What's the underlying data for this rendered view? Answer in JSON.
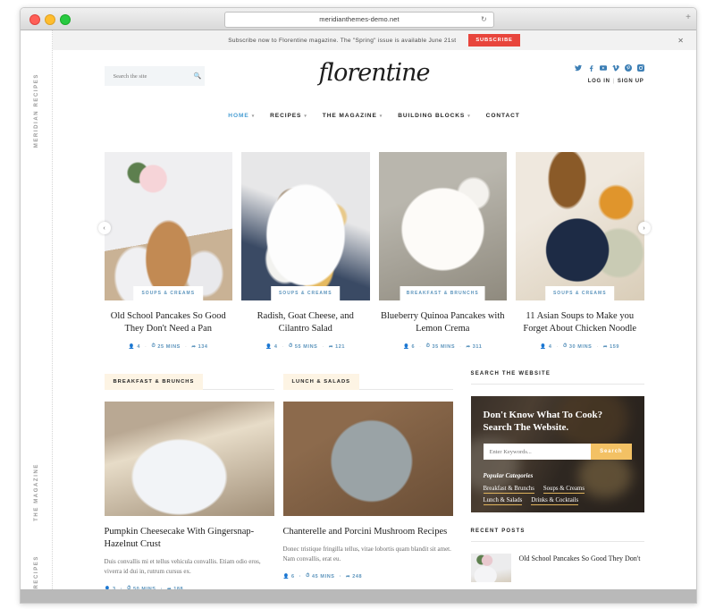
{
  "browser": {
    "url": "meridianthemes-demo.net",
    "reload_icon": "reload-icon",
    "new_tab_icon": "plus-icon"
  },
  "notice": {
    "text": "Subscribe now to Florentine magazine. The \"Spring\" issue is available June 21st",
    "button": "SUBSCRIBE",
    "close": "✕",
    "button_color": "#e8453c"
  },
  "rail": {
    "top": "MERIDIAN RECIPES",
    "bottom_1": "THE MAGAZINE",
    "bottom_2": "RECIPES"
  },
  "header": {
    "brand": "florentine",
    "search_placeholder": "Search the site",
    "search_value": "",
    "search_icon": "search-icon",
    "login": "LOG IN",
    "separator": "|",
    "signup": "SIGN UP",
    "social": [
      {
        "name": "twitter-icon",
        "glyph": "🐦"
      },
      {
        "name": "facebook-icon",
        "glyph": "f"
      },
      {
        "name": "youtube-icon",
        "glyph": "▶"
      },
      {
        "name": "vimeo-icon",
        "glyph": "V"
      },
      {
        "name": "pinterest-icon",
        "glyph": "P"
      },
      {
        "name": "instagram-icon",
        "glyph": "▣"
      }
    ],
    "nav": [
      {
        "label": "HOME",
        "caret": "▾",
        "active": true
      },
      {
        "label": "RECIPES",
        "caret": "▾",
        "active": false
      },
      {
        "label": "THE MAGAZINE",
        "caret": "▾",
        "active": false
      },
      {
        "label": "BUILDING BLOCKS",
        "caret": "▾",
        "active": false
      },
      {
        "label": "CONTACT",
        "caret": "",
        "active": false
      }
    ]
  },
  "carousel": {
    "prev": "‹",
    "next": "›",
    "cards": [
      {
        "category": "SOUPS & CREAMS",
        "title": "Old School Pancakes So Good They Don't Need a Pan",
        "comments": "4",
        "time": "25 MINS",
        "shares": "134"
      },
      {
        "category": "SOUPS & CREAMS",
        "title": "Radish, Goat Cheese, and Cilantro Salad",
        "comments": "4",
        "time": "55 MINS",
        "shares": "121"
      },
      {
        "category": "BREAKFAST & BRUNCHS",
        "title": "Blueberry Quinoa Pancakes with Lemon Crema",
        "comments": "6",
        "time": "35 MINS",
        "shares": "311"
      },
      {
        "category": "SOUPS & CREAMS",
        "title": "11 Asian Soups to Make you Forget About Chicken Noodle",
        "comments": "4",
        "time": "30 MINS",
        "shares": "159"
      }
    ]
  },
  "columns": [
    {
      "section": "BREAKFAST & BRUNCHS",
      "title": "Pumpkin Cheesecake With Gingersnap-Hazelnut Crust",
      "excerpt": "Duis convallis mi et tellus vehicula convallis. Etiam odio eros, viverra id dui in, rutrum cursus ex.",
      "comments": "3",
      "time": "50 MINS",
      "shares": "188"
    },
    {
      "section": "LUNCH & SALADS",
      "title": "Chanterelle and Porcini Mushroom Recipes",
      "excerpt": "Donec tristique fringilla tellus, vitae lobortis quam blandit sit amet. Nam convallis, erat eu.",
      "comments": "6",
      "time": "45 MINS",
      "shares": "248"
    }
  ],
  "sidebar": {
    "search_heading": "SEARCH THE WEBSITE",
    "widget_title_line1": "Don't Know What To Cook?",
    "widget_title_line2": "Search The Website.",
    "widget_placeholder": "Enter Keywords...",
    "widget_value": "",
    "widget_button": "Search",
    "widget_button_color": "#f3c164",
    "popular_heading": "Popular Categories",
    "popular_tags": [
      "Breakfast & Brunchs",
      "Soups & Creams",
      "Lunch & Salads",
      "Drinks & Cocktails"
    ],
    "recent_heading": "RECENT POSTS",
    "recent": [
      {
        "title": "Old School Pancakes So Good They Don't"
      }
    ]
  },
  "icons": {
    "comments": "person-icon",
    "clock": "clock-icon",
    "share": "share-icon"
  }
}
